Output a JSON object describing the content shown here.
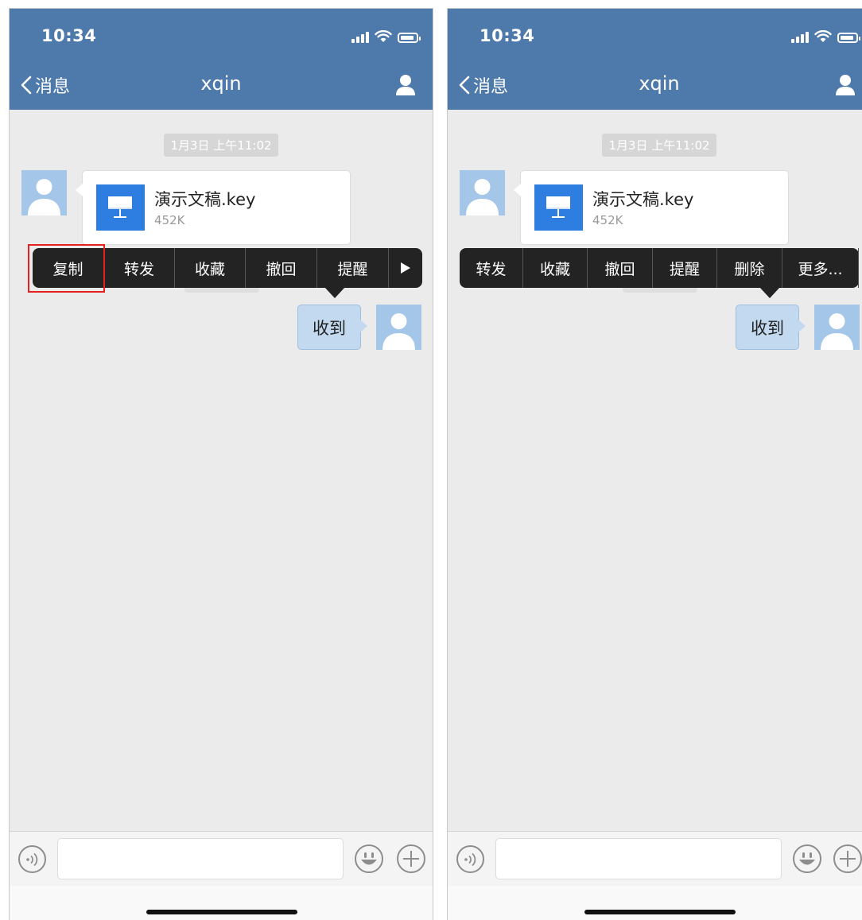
{
  "screens": [
    {
      "status_bar": {
        "time": "10:34"
      },
      "nav": {
        "back_label": "消息",
        "title": "xqin"
      },
      "chat": {
        "timestamp": "1月3日 上午11:02",
        "file_message": {
          "file_name": "演示文稿.key",
          "file_size": "452K",
          "icon": "keynote-presentation-icon"
        },
        "sent_message": {
          "text": "收到"
        }
      },
      "context_menu": {
        "items": [
          "复制",
          "转发",
          "收藏",
          "撤回",
          "提醒"
        ],
        "more_arrow_icon": "triangle-right-icon",
        "highlighted_item": "复制"
      },
      "input_bar": {
        "placeholder": ""
      }
    },
    {
      "status_bar": {
        "time": "10:34"
      },
      "nav": {
        "back_label": "消息",
        "title": "xqin"
      },
      "chat": {
        "timestamp": "1月3日 上午11:02",
        "file_message": {
          "file_name": "演示文稿.key",
          "file_size": "452K",
          "icon": "keynote-presentation-icon"
        },
        "sent_message": {
          "text": "收到"
        }
      },
      "context_menu": {
        "items": [
          "转发",
          "收藏",
          "撤回",
          "提醒",
          "删除",
          "更多..."
        ]
      },
      "input_bar": {
        "placeholder": ""
      }
    }
  ],
  "colors": {
    "nav_bar": "#4e79ab",
    "file_icon_bg": "#2d7ee0",
    "sent_bubble": "#c2d9f0",
    "menu_bg": "#232323",
    "highlight": "#e5201f"
  }
}
